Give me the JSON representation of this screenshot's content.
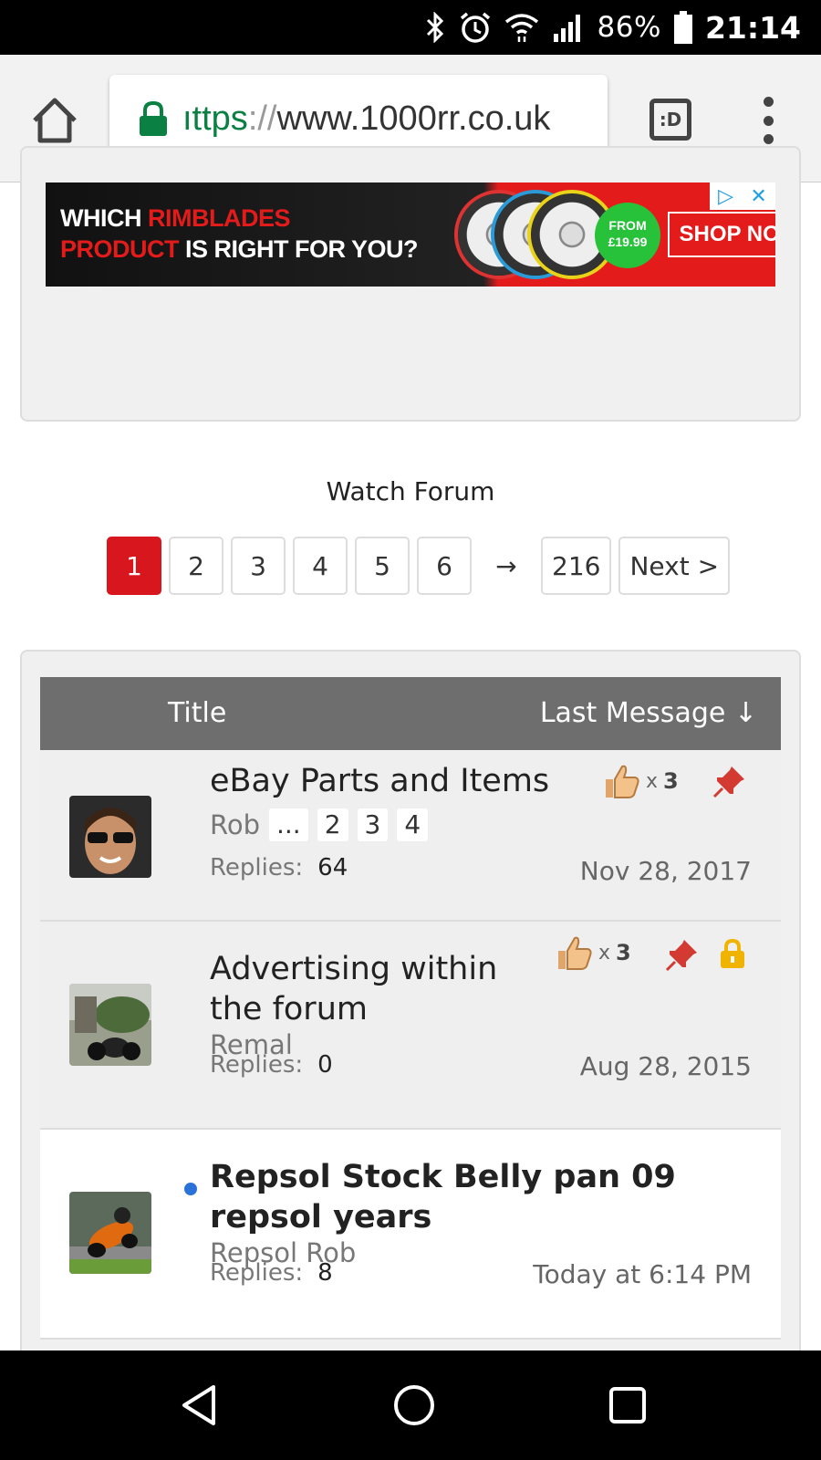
{
  "status_bar": {
    "battery_percent": "86%",
    "time": "21:14",
    "icons": [
      "bluetooth-icon",
      "alarm-icon",
      "wifi-icon",
      "signal-icon",
      "battery-icon"
    ]
  },
  "browser": {
    "url_scheme": "ıttps",
    "url_sep": "://",
    "url_host": "www.1000rr.co.uk",
    "tabs_label": ":D"
  },
  "ad": {
    "line1_a": "WHICH ",
    "line1_b": "RIMBLADES",
    "line2_a": "PRODUCT",
    "line2_b": " IS RIGHT FOR YOU?",
    "from_label": "FROM",
    "price": "£19.99",
    "cta": "SHOP NOW",
    "close_glyph": "✕",
    "adchoice_glyph": "▷"
  },
  "forum": {
    "watch_label": "Watch Forum",
    "pagination": {
      "pages": [
        "1",
        "2",
        "3",
        "4",
        "5",
        "6"
      ],
      "active": "1",
      "arrow": "→",
      "last": "216",
      "next": "Next >"
    },
    "list_header": {
      "title": "Title",
      "last_message": "Last Message ↓"
    },
    "replies_label": "Replies:",
    "threads": [
      {
        "title": "eBay Parts and Items",
        "author": "Rob",
        "mini_pages": [
          "...",
          "2",
          "3",
          "4"
        ],
        "replies": "64",
        "date": "Nov 28, 2017",
        "likes": "x ",
        "likes_count": "3",
        "sticky": true,
        "locked": false,
        "unread": false
      },
      {
        "title": "Advertising within the forum",
        "author": "Remal",
        "replies": "0",
        "date": "Aug 28, 2015",
        "likes": "x ",
        "likes_count": "3",
        "sticky": true,
        "locked": true,
        "unread": false
      },
      {
        "title": "Repsol Stock Belly pan 09 repsol years",
        "author": "Repsol Rob",
        "replies": "8",
        "date": "Today at 6:14 PM",
        "sticky": false,
        "locked": false,
        "unread": true
      }
    ]
  },
  "colors": {
    "accent_red": "#d7161e",
    "header_gray": "#6e6e6e",
    "url_green": "#0b8043",
    "unread_blue": "#2a72d8"
  }
}
